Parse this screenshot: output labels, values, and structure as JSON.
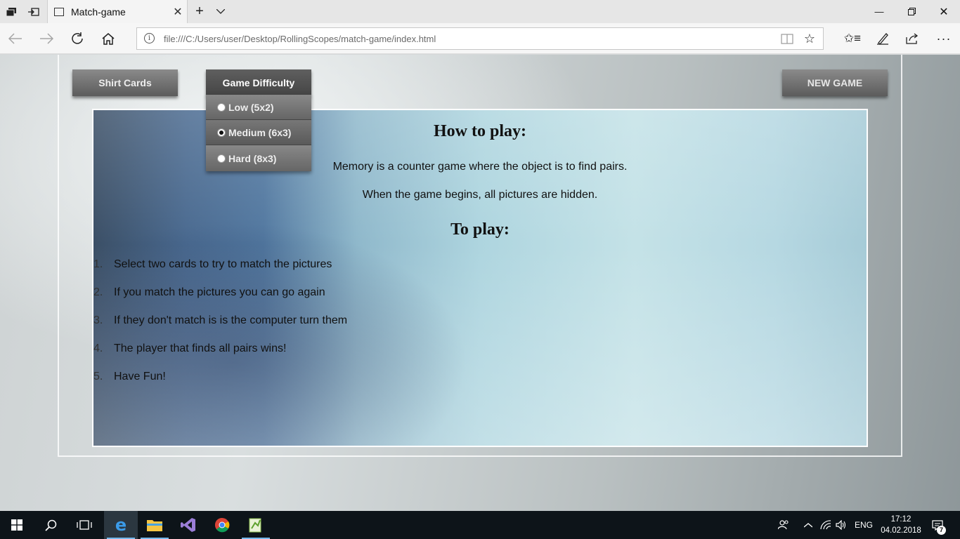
{
  "browser": {
    "tab": {
      "title": "Match-game"
    },
    "address": {
      "url": "file:///C:/Users/user/Desktop/RollingScopes/match-game/index.html"
    },
    "icons": {
      "tab_actions": "tab-actions-icon",
      "tabs_aside": "set-tabs-aside-icon",
      "page": "page-icon",
      "close_tab": "close-icon",
      "new_tab": "plus-icon",
      "tab_list": "chevron-down-icon",
      "back": "back-arrow-icon",
      "forward": "forward-arrow-icon",
      "refresh": "refresh-icon",
      "home": "home-icon",
      "site_info": "info-icon",
      "reading_view": "book-icon",
      "favorite": "star-icon",
      "favorites_hub": "favorites-hub-icon",
      "notes": "pen-icon",
      "share": "share-icon",
      "more": "more-icon",
      "minimize": "minimize-icon",
      "restore": "restore-icon",
      "close_window": "close-icon"
    }
  },
  "page": {
    "buttons": {
      "shirt_cards": "Shirt Cards",
      "difficulty": "Game Difficulty",
      "new_game": "NEW GAME"
    },
    "difficulty_options": [
      {
        "label": "Low (5x2)",
        "selected": false
      },
      {
        "label": "Medium (6x3)",
        "selected": true
      },
      {
        "label": "Hard (8x3)",
        "selected": false
      }
    ],
    "info": {
      "how_title": "How to play:",
      "intro1": "Memory is a counter game where the object is to find pairs.",
      "intro2": "When the game begins, all pictures are hidden.",
      "to_play_title": "To play:",
      "rules": [
        {
          "num": "1.",
          "text": "Select two cards to try to match the pictures"
        },
        {
          "num": "2.",
          "text": "If you match the pictures you can go again"
        },
        {
          "num": "3.",
          "text": "If they don't match is is the computer turn them"
        },
        {
          "num": "4.",
          "text": "The player that finds all pairs wins!"
        },
        {
          "num": "5.",
          "text": "Have Fun!"
        }
      ]
    }
  },
  "taskbar": {
    "apps": [
      "windows-start-icon",
      "search-icon",
      "task-view-icon",
      "edge-icon",
      "file-explorer-icon",
      "visual-studio-icon",
      "chrome-icon",
      "notepad-plus-plus-icon"
    ],
    "language": "ENG",
    "time": "17:12",
    "date": "04.02.2018",
    "notifications_count": "7"
  },
  "colors": {
    "button_grey": "#707070",
    "panel_blue": "#aed5df",
    "taskbar": "#0d1419"
  }
}
